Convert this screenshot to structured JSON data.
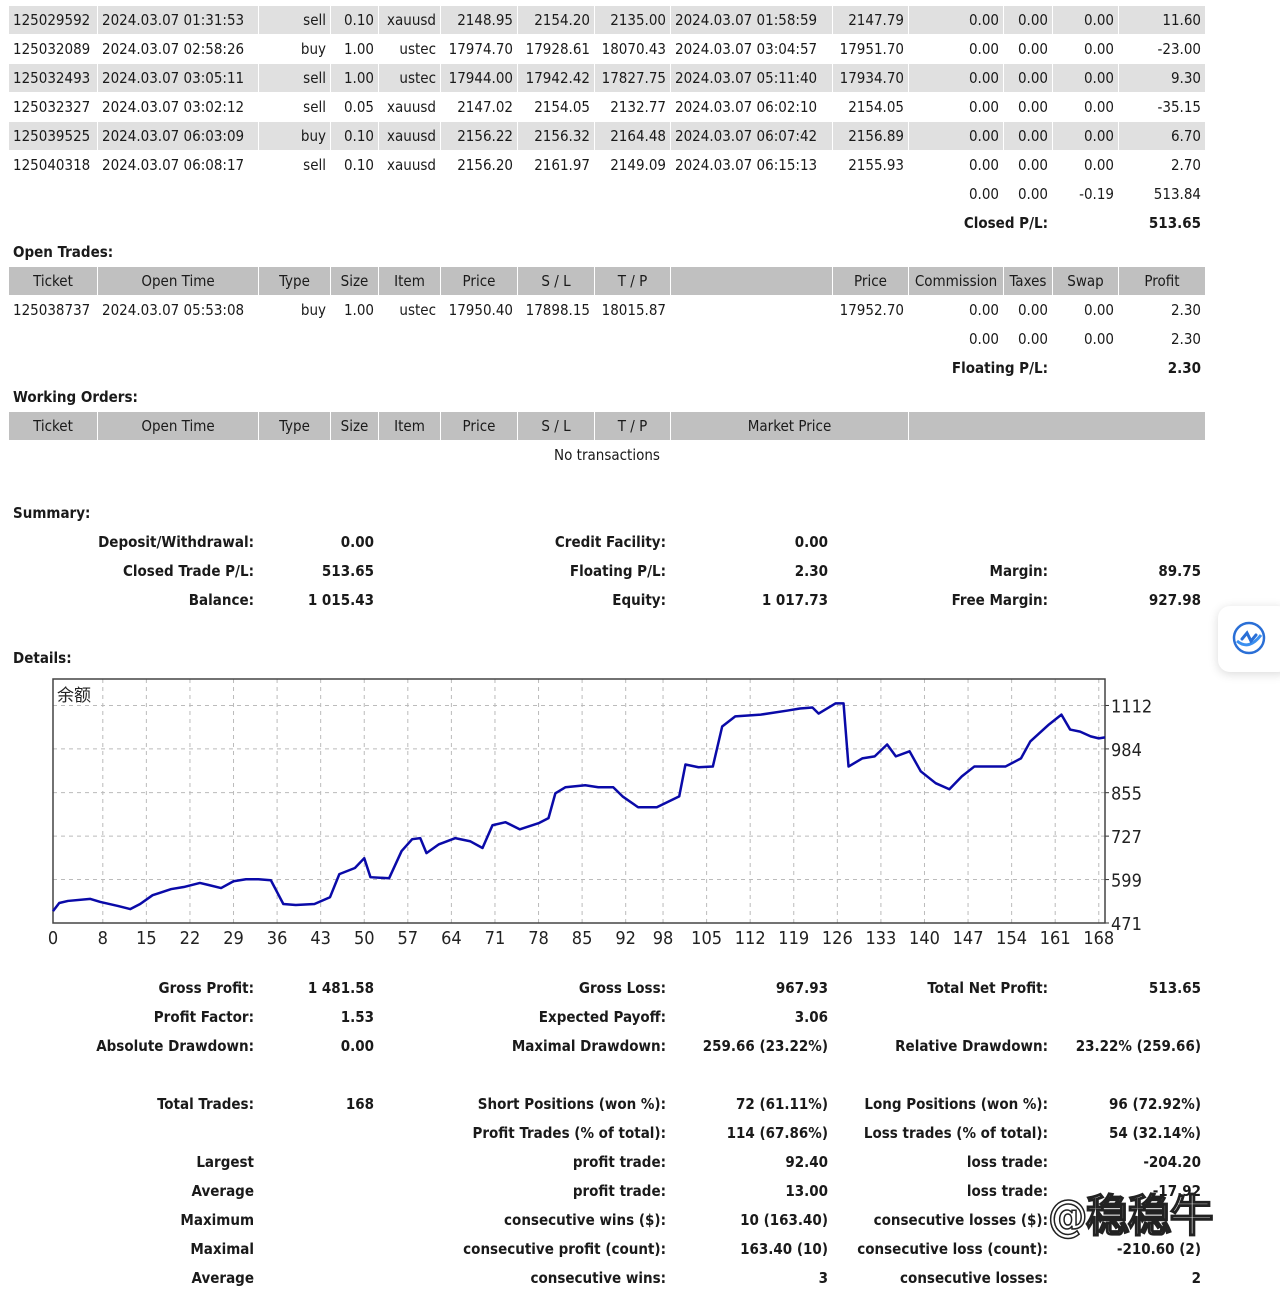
{
  "closed_trades": {
    "rows": [
      [
        "125029592",
        "2024.03.07 01:31:53",
        "sell",
        "0.10",
        "xauusd",
        "2148.95",
        "2154.20",
        "2135.00",
        "2024.03.07 01:58:59",
        "2147.79",
        "0.00",
        "0.00",
        "0.00",
        "11.60"
      ],
      [
        "125032089",
        "2024.03.07 02:58:26",
        "buy",
        "1.00",
        "ustec",
        "17974.70",
        "17928.61",
        "18070.43",
        "2024.03.07 03:04:57",
        "17951.70",
        "0.00",
        "0.00",
        "0.00",
        "-23.00"
      ],
      [
        "125032493",
        "2024.03.07 03:05:11",
        "sell",
        "1.00",
        "ustec",
        "17944.00",
        "17942.42",
        "17827.75",
        "2024.03.07 05:11:40",
        "17934.70",
        "0.00",
        "0.00",
        "0.00",
        "9.30"
      ],
      [
        "125032327",
        "2024.03.07 03:02:12",
        "sell",
        "0.05",
        "xauusd",
        "2147.02",
        "2154.05",
        "2132.77",
        "2024.03.07 06:02:10",
        "2154.05",
        "0.00",
        "0.00",
        "0.00",
        "-35.15"
      ],
      [
        "125039525",
        "2024.03.07 06:03:09",
        "buy",
        "0.10",
        "xauusd",
        "2156.22",
        "2156.32",
        "2164.48",
        "2024.03.07 06:07:42",
        "2156.89",
        "0.00",
        "0.00",
        "0.00",
        "6.70"
      ],
      [
        "125040318",
        "2024.03.07 06:08:17",
        "sell",
        "0.10",
        "xauusd",
        "2156.20",
        "2161.97",
        "2149.09",
        "2024.03.07 06:15:13",
        "2155.93",
        "0.00",
        "0.00",
        "0.00",
        "2.70"
      ]
    ],
    "totals": [
      "0.00",
      "0.00",
      "-0.19",
      "513.84"
    ],
    "pl_label": "Closed P/L:",
    "pl_value": "513.65"
  },
  "open_trades": {
    "title": "Open Trades:",
    "headers": [
      "Ticket",
      "Open Time",
      "Type",
      "Size",
      "Item",
      "Price",
      "S / L",
      "T / P",
      "",
      "Price",
      "Commission",
      "Taxes",
      "Swap",
      "Profit"
    ],
    "rows": [
      [
        "125038737",
        "2024.03.07 05:53:08",
        "buy",
        "1.00",
        "ustec",
        "17950.40",
        "17898.15",
        "18015.87",
        "",
        "17952.70",
        "0.00",
        "0.00",
        "0.00",
        "2.30"
      ]
    ],
    "totals": [
      "0.00",
      "0.00",
      "0.00",
      "2.30"
    ],
    "pl_label": "Floating P/L:",
    "pl_value": "2.30"
  },
  "working_orders": {
    "title": "Working Orders:",
    "headers": [
      "Ticket",
      "Open Time",
      "Type",
      "Size",
      "Item",
      "Price",
      "S / L",
      "T / P",
      "Market Price",
      ""
    ],
    "empty_text": "No transactions"
  },
  "summary": {
    "title": "Summary:",
    "rows": [
      [
        "Deposit/Withdrawal:",
        "0.00",
        "Credit Facility:",
        "0.00",
        "",
        ""
      ],
      [
        "Closed Trade P/L:",
        "513.65",
        "Floating P/L:",
        "2.30",
        "Margin:",
        "89.75"
      ],
      [
        "Balance:",
        "1 015.43",
        "Equity:",
        "1 017.73",
        "Free Margin:",
        "927.98"
      ]
    ]
  },
  "details": {
    "title": "Details:",
    "stats": [
      [
        "Gross Profit:",
        "1 481.58",
        "Gross Loss:",
        "967.93",
        "Total Net Profit:",
        "513.65"
      ],
      [
        "Profit Factor:",
        "1.53",
        "Expected Payoff:",
        "3.06",
        "",
        ""
      ],
      [
        "Absolute Drawdown:",
        "0.00",
        "Maximal Drawdown:",
        "259.66 (23.22%)",
        "Relative Drawdown:",
        "23.22% (259.66)"
      ],
      [
        "",
        "",
        "",
        "",
        "",
        ""
      ],
      [
        "Total Trades:",
        "168",
        "Short Positions (won %):",
        "72 (61.11%)",
        "Long Positions (won %):",
        "96 (72.92%)"
      ],
      [
        "",
        "",
        "Profit Trades (% of total):",
        "114 (67.86%)",
        "Loss trades (% of total):",
        "54 (32.14%)"
      ],
      [
        "Largest",
        "",
        "profit trade:",
        "92.40",
        "loss trade:",
        "-204.20"
      ],
      [
        "Average",
        "",
        "profit trade:",
        "13.00",
        "loss trade:",
        "-17.92"
      ],
      [
        "Maximum",
        "",
        "consecutive wins ($):",
        "10 (163.40)",
        "consecutive losses ($):",
        ""
      ],
      [
        "Maximal",
        "",
        "consecutive profit (count):",
        "163.40 (10)",
        "consecutive loss (count):",
        "-210.60 (2)"
      ],
      [
        "Average",
        "",
        "consecutive wins:",
        "3",
        "consecutive losses:",
        "2"
      ]
    ]
  },
  "chart_data": {
    "type": "line",
    "title": "余额",
    "x_ticks": [
      0,
      8,
      15,
      22,
      29,
      36,
      43,
      50,
      57,
      64,
      71,
      78,
      85,
      92,
      98,
      105,
      112,
      119,
      126,
      133,
      140,
      147,
      154,
      161,
      168
    ],
    "y_ticks": [
      471,
      599,
      727,
      855,
      984,
      1112
    ],
    "xlim": [
      0,
      169
    ],
    "ylim": [
      471,
      1190
    ],
    "grid": true,
    "line_color": "#0a0aa8",
    "series": [
      {
        "x": [
          0,
          1,
          2.4,
          6,
          7.6,
          10.5,
          12.4,
          14,
          16,
          17,
          19,
          21,
          23.6,
          25,
          27,
          29,
          31,
          33,
          35,
          37,
          39,
          42,
          44.5,
          46,
          48.5,
          50,
          51,
          54,
          56,
          57.7,
          59,
          60,
          62,
          64.6,
          67,
          69,
          70.6,
          72.7,
          75,
          78,
          79.6,
          80.7,
          82.3,
          85.5,
          87.6,
          90,
          91.5,
          94,
          97,
          100.6,
          101.6,
          103.7,
          106,
          107.5,
          109.6,
          113.7,
          118,
          120,
          122,
          123,
          125.7,
          127,
          127.8,
          130,
          132,
          134,
          135.4,
          137.6,
          139.4,
          141.8,
          144,
          146,
          148,
          150.6,
          153,
          155.5,
          157,
          160,
          162,
          163.4,
          165,
          166.7,
          168,
          169
        ],
        "y": [
          506,
          530,
          536,
          542,
          533,
          521,
          512,
          527,
          553,
          559,
          571,
          577,
          589,
          583,
          574,
          594,
          600,
          600,
          597,
          527,
          524,
          527,
          547,
          615,
          633,
          662,
          606,
          603,
          683,
          718,
          721,
          677,
          703,
          721,
          712,
          692,
          759,
          768,
          747,
          765,
          780,
          853,
          871,
          877,
          871,
          871,
          844,
          812,
          812,
          844,
          938,
          930,
          932,
          1050,
          1080,
          1085,
          1097,
          1103,
          1106,
          1088,
          1118,
          1118,
          932,
          956,
          962,
          997,
          962,
          977,
          918,
          883,
          865,
          903,
          932,
          932,
          932,
          956,
          1006,
          1056,
          1085,
          1041,
          1035,
          1021,
          1015,
          1018
        ]
      }
    ]
  },
  "watermark": "@稳稳牛",
  "float_button_icon": "assistant-logo-icon"
}
